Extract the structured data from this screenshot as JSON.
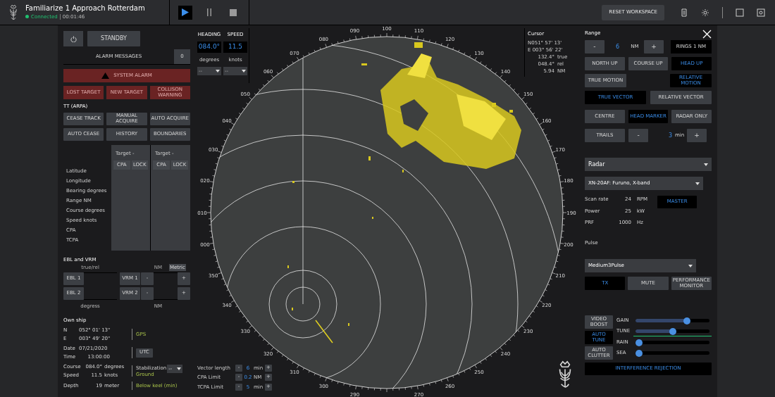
{
  "header": {
    "title": "Familiarize 1 Approach Rotterdam",
    "status": "Connected",
    "elapsed": "00:01:46",
    "playback": [
      {
        "kind": "play",
        "selected": true
      },
      {
        "kind": "pause",
        "selected": false
      },
      {
        "kind": "stop",
        "selected": false
      }
    ],
    "reset_button": "RESET WORKSPACE",
    "tools": [
      {
        "kind": "document"
      },
      {
        "kind": "brightness"
      },
      {
        "kind": "grid"
      },
      {
        "kind": "screen"
      }
    ]
  },
  "left_panel": {
    "standby": "STANDBY",
    "alarm_messages": {
      "label": "ALARM MESSAGES",
      "count": "0"
    },
    "system_alarm": {
      "label": "SYSTEM ALARM",
      "active": true
    },
    "alarms": [
      {
        "label": "LOST TARGET",
        "active": true
      },
      {
        "label": "NEW TARGET",
        "active": true
      },
      {
        "label": "COLLISON WARNING",
        "active": true
      }
    ],
    "tt": {
      "title": "TT (ARPA)",
      "buttons": [
        "CEASE TRACK",
        "MANUAL ACQUIRE",
        "AUTO ACQUIRE",
        "AUTO CEASE",
        "HISTORY",
        "BOUNDARIES"
      ],
      "targets": [
        {
          "title": "Target -",
          "buttons": [
            "CPA",
            "LOCK"
          ]
        },
        {
          "title": "Target -",
          "buttons": [
            "CPA",
            "LOCK"
          ]
        }
      ],
      "rows": [
        "Latitude",
        "Longitude",
        "Bearing degrees",
        "Range NM",
        "Course degrees",
        "Speed knots",
        "CPA",
        "TCPA"
      ]
    },
    "ebl_vrm": {
      "title": "EBL and VRM",
      "header_left": "true/rel",
      "header_right": "NM",
      "metric": "Metric",
      "ebl": [
        "EBL 1",
        "EBL 2"
      ],
      "vrm": [
        {
          "label": "VRM 1",
          "minus": "-",
          "plus": "+"
        },
        {
          "label": "VRM 2",
          "minus": "-",
          "plus": "+"
        }
      ],
      "footer_left": "degress",
      "footer_right": "NM"
    },
    "own_ship": {
      "title": "Own ship",
      "position": [
        {
          "label": "N",
          "value": "052° 01' 13\""
        },
        {
          "label": "E",
          "value": "003° 49' 20\""
        }
      ],
      "source": "GPS",
      "date": {
        "label": "Date",
        "value": "07/21/2020"
      },
      "time": {
        "label": "Time",
        "value": "13:00:00"
      },
      "zone": "UTC",
      "course": {
        "label": "Course",
        "value": "084.0°",
        "unit": "degrees"
      },
      "speed": {
        "label": "Speed",
        "value": "11.5",
        "unit": "knots"
      },
      "stabilization": {
        "label": "Stabilization",
        "value": "--",
        "mode": "Ground"
      },
      "depth": {
        "label": "Depth",
        "value": "19",
        "unit": "meter",
        "note": "Below keel (min)"
      }
    }
  },
  "nav": {
    "items": [
      {
        "label": "HEADING",
        "value": "084.0°",
        "unit": "degrees",
        "select": "--"
      },
      {
        "label": "SPEED",
        "value": "11.5",
        "unit": "knots",
        "select": "--"
      }
    ]
  },
  "radar_display": {
    "bearing_labels": [
      "000",
      "010",
      "020",
      "030",
      "040",
      "050",
      "060",
      "070",
      "080",
      "090",
      "100",
      "110",
      "120",
      "130",
      "140",
      "150",
      "160",
      "170",
      "180",
      "190",
      "200",
      "210",
      "220",
      "230",
      "240",
      "250",
      "260",
      "270",
      "290",
      "300",
      "310",
      "320",
      "330",
      "340",
      "350"
    ]
  },
  "cursor": {
    "title": "Cursor",
    "lat": "N051° 57' 13'",
    "lon": "E 003° 56' 22'",
    "readings": [
      {
        "value": "132.4°",
        "unit": "true"
      },
      {
        "value": "048.4°",
        "unit": "rel"
      },
      {
        "value": "5.94",
        "unit": "NM"
      }
    ]
  },
  "limits": [
    {
      "label": "Vector length",
      "minus": "-",
      "value": "6",
      "unit": "min",
      "plus": "+"
    },
    {
      "label": "CPA Limit",
      "minus": "-",
      "value": "0.2",
      "unit": "NM",
      "plus": "+"
    },
    {
      "label": "TCPA Limit",
      "minus": "-",
      "value": "5",
      "unit": "min",
      "plus": "+"
    }
  ],
  "right_panel": {
    "range": {
      "title": "Range",
      "minus": "-",
      "value": "6",
      "unit": "NM",
      "plus": "+",
      "rings": "RINGS 1 NM"
    },
    "orientation": [
      {
        "label": "NORTH UP",
        "selected": false
      },
      {
        "label": "COURSE UP",
        "selected": false
      },
      {
        "label": "HEAD UP",
        "selected": true
      }
    ],
    "motion": [
      {
        "label": "TRUE MOTION",
        "selected": false
      },
      {
        "label": "RELATIVE MOTION",
        "selected": true
      }
    ],
    "vector": [
      {
        "label": "TRUE VECTOR",
        "selected": true
      },
      {
        "label": "RELATIVE VECTOR",
        "selected": false
      }
    ],
    "display": [
      {
        "label": "CENTRE",
        "selected": false
      },
      {
        "label": "HEAD MARKER",
        "selected": true
      },
      {
        "label": "RADAR ONLY",
        "selected": false
      }
    ],
    "trails": {
      "label": "TRAILS",
      "minus": "-",
      "value": "3",
      "unit": "min",
      "plus": "+"
    },
    "radar": {
      "source": "Radar",
      "model": "XN-20AF: Furuno, X-band",
      "specs": [
        {
          "label": "Scan rate",
          "value": "24",
          "unit": "RPM"
        },
        {
          "label": "Power",
          "value": "25",
          "unit": "kW"
        },
        {
          "label": "PRF",
          "value": "1000",
          "unit": "Hz"
        }
      ],
      "master": {
        "label": "MASTER",
        "selected": true
      },
      "pulse_label": "Pulse",
      "pulse": "Medium3Pulse",
      "modes": [
        {
          "label": "TX",
          "selected": true
        },
        {
          "label": "MUTE",
          "selected": false
        },
        {
          "label": "PERFORMANCE MONITOR",
          "selected": false
        }
      ],
      "toggles": [
        {
          "label": "VIDEO BOOST",
          "on": false
        },
        {
          "label": "AUTO TUNE",
          "on": true
        },
        {
          "label": "AUTO CLUTTER",
          "on": false
        }
      ],
      "sliders": [
        {
          "label": "GAIN",
          "level": 0.72
        },
        {
          "label": "TUNE",
          "level": 0.5
        },
        {
          "label": "RAIN",
          "level": 0
        },
        {
          "label": "SEA",
          "level": 0
        }
      ],
      "interference": {
        "label": "INTERFERENCE REJECTION",
        "on": true
      }
    }
  }
}
